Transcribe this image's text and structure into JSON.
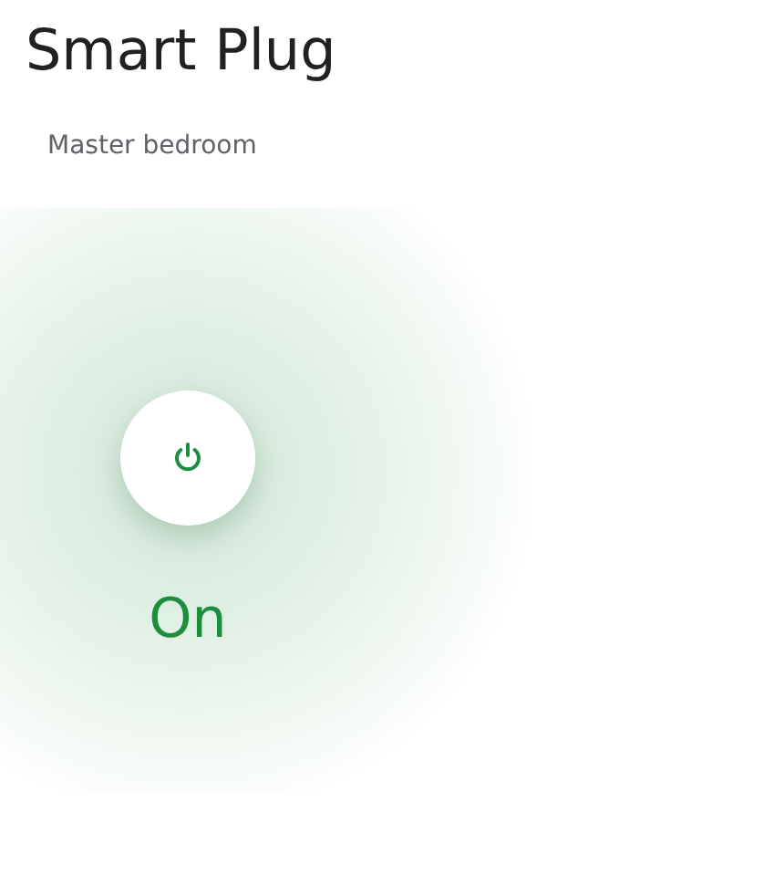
{
  "device": {
    "title": "Smart Plug",
    "room": "Master bedroom",
    "on": true,
    "status": "On"
  }
}
